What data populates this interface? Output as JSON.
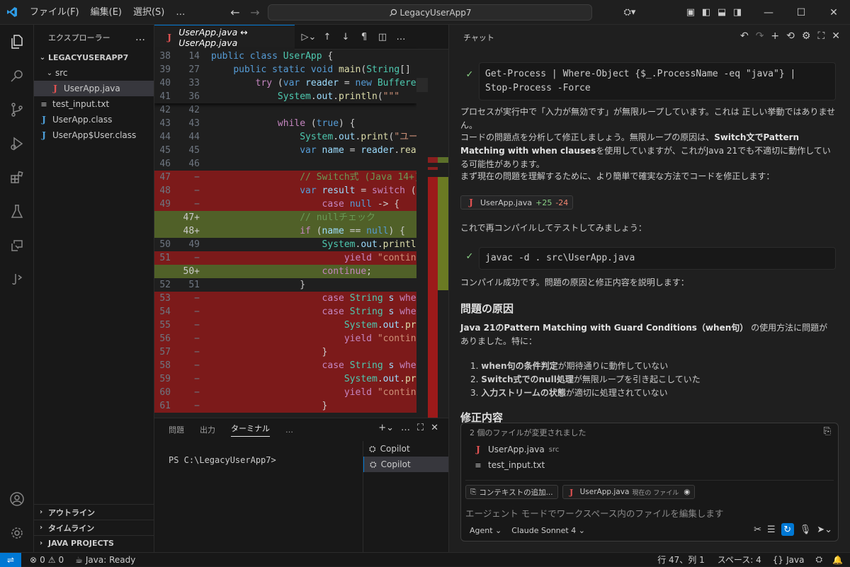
{
  "titlebar": {
    "menus": [
      "ファイル(F)",
      "編集(E)",
      "選択(S)",
      "…"
    ],
    "search_text": "LegacyUserApp7"
  },
  "sidebar": {
    "title": "エクスプローラー",
    "more": "…",
    "project": "LEGACYUSERAPP7",
    "folder": "src",
    "files": [
      {
        "name": "UserApp.java",
        "icon": "java-icon"
      },
      {
        "name": "test_input.txt",
        "icon": "text-file-icon"
      },
      {
        "name": "UserApp.class",
        "icon": "class-file-icon"
      },
      {
        "name": "UserApp$User.class",
        "icon": "class-file-icon"
      }
    ],
    "sections": [
      "アウトライン",
      "タイムライン",
      "JAVA PROJECTS"
    ]
  },
  "editor": {
    "tab_label": "UserApp.java ↔ UserApp.java",
    "sticky_lines": [
      {
        "a": "38",
        "b": "14"
      },
      {
        "a": "39",
        "b": "27"
      },
      {
        "a": "40",
        "b": "33"
      },
      {
        "a": "41",
        "b": "36"
      }
    ],
    "lines": [
      {
        "a": "42",
        "b": "42"
      },
      {
        "a": "43",
        "b": "43"
      },
      {
        "a": "44",
        "b": "44"
      },
      {
        "a": "45",
        "b": "45"
      },
      {
        "a": "46",
        "b": "46"
      },
      {
        "a": "47",
        "b": "−"
      },
      {
        "a": "48",
        "b": "−"
      },
      {
        "a": "49",
        "b": "−"
      },
      {
        "a": "",
        "b": "47+"
      },
      {
        "a": "",
        "b": "48+"
      },
      {
        "a": "50",
        "b": "49"
      },
      {
        "a": "51",
        "b": "−"
      },
      {
        "a": "",
        "b": "50+"
      },
      {
        "a": "52",
        "b": "51"
      },
      {
        "a": "53",
        "b": "−"
      },
      {
        "a": "54",
        "b": "−"
      },
      {
        "a": "55",
        "b": "−"
      },
      {
        "a": "56",
        "b": "−"
      },
      {
        "a": "57",
        "b": "−"
      },
      {
        "a": "58",
        "b": "−"
      },
      {
        "a": "59",
        "b": "−"
      },
      {
        "a": "60",
        "b": "−"
      },
      {
        "a": "61",
        "b": "−"
      }
    ]
  },
  "panel": {
    "tabs": [
      "問題",
      "出力",
      "ターミナル",
      "…"
    ],
    "prompt": "PS C:\\LegacyUserApp7>",
    "terminals": [
      "Copilot",
      "Copilot"
    ]
  },
  "chat": {
    "title": "チャット",
    "cmd1_line1": "Get-Process | Where-Object {$_.ProcessName -eq \"java\"} |",
    "cmd1_line2": "Stop-Process -Force",
    "p1": "プロセスが実行中で「入力が無効です」が無限ループしています。これは 正しい挙動ではありません。",
    "p2a": "コードの問題点を分析して修正しましょう。無限ループの原因は、",
    "p2b": "Switch文でPattern Matching with when clauses",
    "p2c": "を使用していますが、これがJava 21でも不適切に動作している可能性があります。",
    "p3": "まず現在の問題を理解するために、より簡単で確実な方法でコードを修正します：",
    "file_chip": {
      "name": "UserApp.java",
      "added": "+25",
      "removed": "-24"
    },
    "p4": "これで再コンパイルしてテストしてみましょう：",
    "cmd2": "javac -d . src\\UserApp.java",
    "p5": "コンパイル成功です。問題の原因と修正内容を説明します：",
    "h_problem": "問題の原因",
    "p6a": "Java 21のPattern Matching with Guard Conditions（when句）",
    "p6b": " の使用方法に問題がありました。特に：",
    "list": [
      {
        "bold": "when句の条件判定",
        "rest": "が期待通りに動作していない"
      },
      {
        "bold": "Switch式でのnull処理",
        "rest": "が無限ループを引き起こしていた"
      },
      {
        "bold": "入力ストリームの状態",
        "rest": "が適切に処理されていない"
      }
    ],
    "h_fix": "修正内容",
    "changed_files_label": "2 個のファイルが変更されました",
    "changed_files": [
      {
        "name": "UserApp.java",
        "dir": "src"
      },
      {
        "name": "test_input.txt",
        "dir": ""
      }
    ],
    "context_add": "コンテキストの追加...",
    "current_file": "UserApp.java",
    "current_file_label": "現在の ファイル",
    "input_placeholder": "エージェント モードでワークスペース内のファイルを編集します",
    "mode": "Agent",
    "model": "Claude Sonnet 4"
  },
  "status": {
    "errors": "0",
    "warnings": "0",
    "java": "Java: Ready",
    "cursor": "行 47、列 1",
    "spaces": "スペース: 4",
    "lang": "Java"
  }
}
